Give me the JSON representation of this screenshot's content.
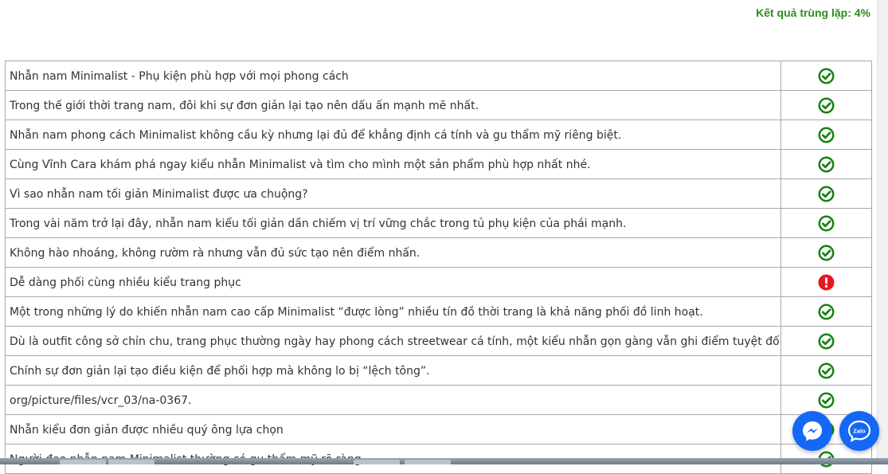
{
  "header": {
    "result_text": "Kết quả trùng lặp: 4%"
  },
  "colors": {
    "ok": "#168216",
    "error": "#e5181f",
    "header_text": "#2e8b1e",
    "fab": "#1468f5"
  },
  "rows": [
    {
      "text": "Nhẫn nam Minimalist - Phụ kiện phù hợp với mọi phong cách",
      "status": "ok",
      "icon": "check-circle-icon"
    },
    {
      "text": "Trong thế giới thời trang nam, đôi khi sự đơn giản lại tạo nên dấu ấn mạnh mẽ nhất.",
      "status": "ok",
      "icon": "check-circle-icon"
    },
    {
      "text": "Nhẫn nam phong cách Minimalist không cầu kỳ nhưng lại đủ để khẳng định cá tính và gu thẩm mỹ riêng biệt.",
      "status": "ok",
      "icon": "check-circle-icon"
    },
    {
      "text": "Cùng Vĩnh Cara khám phá ngay kiểu nhẫn Minimalist và tìm cho mình một sản phẩm phù hợp nhất nhé.",
      "status": "ok",
      "icon": "check-circle-icon"
    },
    {
      "text": "Vì sao nhẫn nam tối giản Minimalist được ưa chuộng?",
      "status": "ok",
      "icon": "check-circle-icon"
    },
    {
      "text": "Trong vài năm trở lại đây, nhẫn nam kiểu tối giản dần chiếm vị trí vững chắc trong tủ phụ kiện của phái mạnh.",
      "status": "ok",
      "icon": "check-circle-icon"
    },
    {
      "text": "Không hào nhoáng, không rườm rà nhưng vẫn đủ sức tạo nên điểm nhấn.",
      "status": "ok",
      "icon": "check-circle-icon"
    },
    {
      "text": "Dễ dàng phối cùng nhiều kiểu trang phục",
      "status": "error",
      "icon": "exclamation-circle-icon"
    },
    {
      "text": "Một trong những lý do khiến nhẫn nam cao cấp Minimalist “được lòng” nhiều tín đồ thời trang là khả năng phối đồ linh hoạt.",
      "status": "ok",
      "icon": "check-circle-icon"
    },
    {
      "text": "Dù là outfit công sở chỉn chu, trang phục thường ngày hay phong cách streetwear cá tính, một kiểu nhẫn gọn gàng vẫn ghi điểm tuyệt đối.",
      "status": "ok",
      "icon": "check-circle-icon"
    },
    {
      "text": "Chính sự đơn giản lại tạo điều kiện để phối hợp mà không lo bị “lệch tông”.",
      "status": "ok",
      "icon": "check-circle-icon"
    },
    {
      "text": "org/picture/files/vcr_03/na-0367.",
      "status": "ok",
      "icon": "check-circle-icon"
    },
    {
      "text": "Nhẫn kiểu đơn giản được nhiều quý ông lựa chọn",
      "status": "ok",
      "icon": "check-circle-icon"
    },
    {
      "text": "Người đeo nhẫn nam Minimalist thường có gu thẩm mỹ rõ ràng.",
      "status": "ok",
      "icon": "check-circle-icon"
    }
  ],
  "floating_buttons": {
    "messenger": {
      "icon": "messenger-icon"
    },
    "zalo": {
      "icon": "zalo-icon",
      "label": "Zalo"
    }
  }
}
